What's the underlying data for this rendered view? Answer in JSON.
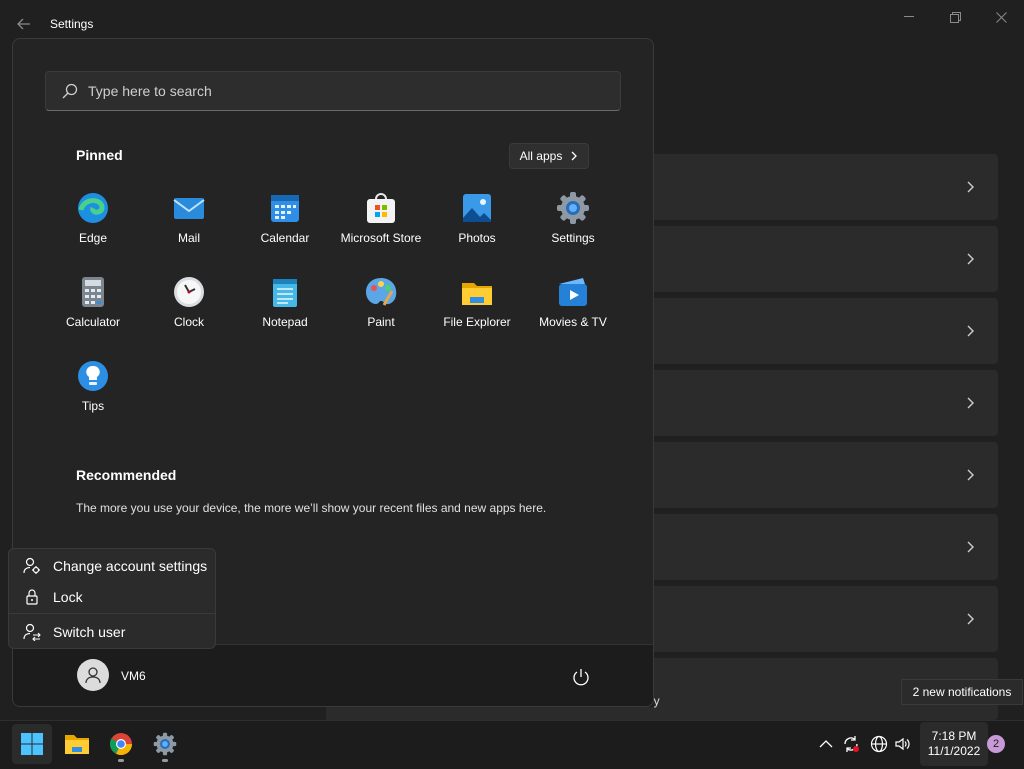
{
  "window": {
    "title": "Settings",
    "partial_text": "ory"
  },
  "search": {
    "placeholder": "Type here to search"
  },
  "pinned": {
    "title": "Pinned",
    "all_apps_label": "All apps",
    "apps": [
      {
        "label": "Edge",
        "icon": "edge-icon"
      },
      {
        "label": "Mail",
        "icon": "mail-icon"
      },
      {
        "label": "Calendar",
        "icon": "calendar-icon"
      },
      {
        "label": "Microsoft Store",
        "icon": "store-icon"
      },
      {
        "label": "Photos",
        "icon": "photos-icon"
      },
      {
        "label": "Settings",
        "icon": "settings-gear-icon"
      },
      {
        "label": "Calculator",
        "icon": "calculator-icon"
      },
      {
        "label": "Clock",
        "icon": "clock-icon"
      },
      {
        "label": "Notepad",
        "icon": "notepad-icon"
      },
      {
        "label": "Paint",
        "icon": "paint-icon"
      },
      {
        "label": "File Explorer",
        "icon": "folder-icon"
      },
      {
        "label": "Movies & TV",
        "icon": "movies-icon"
      },
      {
        "label": "Tips",
        "icon": "tips-icon"
      }
    ]
  },
  "recommended": {
    "title": "Recommended",
    "text": "The more you use your device, the more we’ll show your recent files and new apps here."
  },
  "account_menu": {
    "items": [
      {
        "label": "Change account settings",
        "icon": "person-gear-icon"
      },
      {
        "label": "Lock",
        "icon": "lock-icon"
      },
      {
        "label": "Switch user",
        "icon": "switch-user-icon"
      }
    ]
  },
  "user": {
    "name": "VM6"
  },
  "taskbar": {
    "apps": [
      "start-icon",
      "file-explorer-icon",
      "chrome-icon",
      "settings-icon"
    ],
    "clock": {
      "time": "7:18 PM",
      "date": "11/1/2022"
    },
    "notification_count": "2",
    "notification_tooltip": "2 new notifications"
  },
  "colors": {
    "accent": "#0078d4",
    "background": "#202020",
    "panel": "#242424"
  }
}
